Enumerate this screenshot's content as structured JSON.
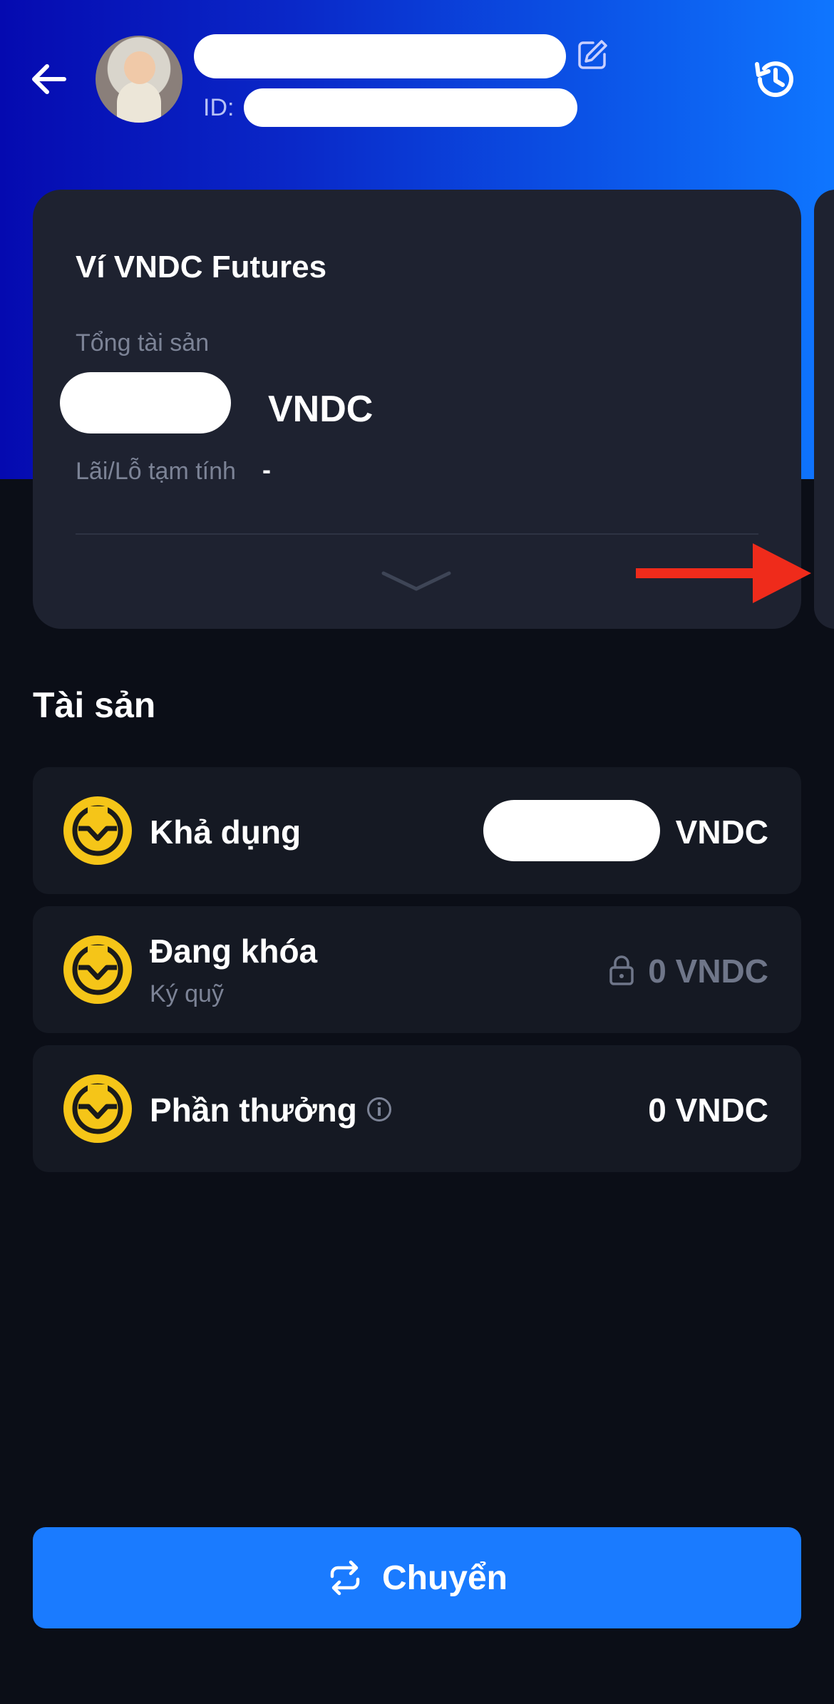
{
  "header": {
    "id_label": "ID:"
  },
  "wallet_card": {
    "title": "Ví VNDC Futures",
    "total_assets_label": "Tổng tài sản",
    "total_assets_unit": "VNDC",
    "pnl_label": "Lãi/Lỗ tạm tính",
    "pnl_value": "-"
  },
  "assets": {
    "title": "Tài sản",
    "items": [
      {
        "name": "Khả dụng",
        "sub": "",
        "value": "VNDC"
      },
      {
        "name": "Đang khóa",
        "sub": "Ký quỹ",
        "value": "0 VNDC"
      },
      {
        "name": "Phần thưởng",
        "sub": "",
        "value": "0 VNDC"
      }
    ]
  },
  "transfer_button": {
    "label": "Chuyển"
  },
  "colors": {
    "primary_blue": "#1a7bff",
    "coin_yellow": "#f5c518",
    "card_bg": "#1e2230",
    "row_bg": "#151923",
    "annotation_red": "#ef2b1b"
  },
  "icons": [
    "back-arrow-icon",
    "edit-icon",
    "history-icon",
    "chevron-down-icon",
    "coin-icon",
    "lock-icon",
    "info-icon",
    "transfer-icon"
  ]
}
